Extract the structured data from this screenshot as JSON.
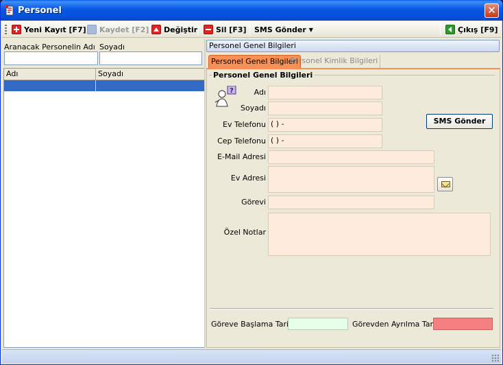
{
  "window": {
    "title": "Personel"
  },
  "toolbar": {
    "new_label": "Yeni Kayıt [F7]",
    "save_label": "Kaydet [F2]",
    "edit_label": "Değiştir",
    "delete_label": "Sil  [F3]",
    "sms_label": "SMS Gönder",
    "exit_label": "Çıkış [F9]"
  },
  "search": {
    "name_label": "Aranacak Personelin Adı",
    "surname_label": "Soyadı",
    "name_value": "",
    "surname_value": ""
  },
  "grid": {
    "columns": [
      "Adı",
      "Soyadı"
    ],
    "rows": [
      [
        "",
        ""
      ]
    ]
  },
  "details": {
    "panel_title": "Personel Genel Bilgileri",
    "tabs": [
      "Personel Genel Bilgileri",
      "Personel Kimlik Bilgileri"
    ],
    "group_title": "Personel Genel Bilgileri",
    "fields": {
      "ad": {
        "label": "Adı",
        "value": ""
      },
      "soyad": {
        "label": "Soyadı",
        "value": ""
      },
      "ev_tel": {
        "label": "Ev Telefonu",
        "value": "(   )   -"
      },
      "cep_tel": {
        "label": "Cep Telefonu",
        "value": "(   )   -"
      },
      "email": {
        "label": "E-Mail Adresi",
        "value": ""
      },
      "ev_adres": {
        "label": "Ev Adresi",
        "value": ""
      },
      "gorev": {
        "label": "Görevi",
        "value": ""
      },
      "notlar": {
        "label": "Özel Notlar",
        "value": ""
      }
    },
    "sms_button": "SMS Gönder",
    "start_date_label": "Göreve Başlama Tarihi",
    "end_date_label": "Görevden Ayrılma Tarihi",
    "start_date_value": "",
    "end_date_value": ""
  },
  "colors": {
    "title_bar": "#0a5fef",
    "active_tab": "#f59056",
    "field_bg": "#fdebdc",
    "selected_row": "#316ac5",
    "start_date_bg": "#e6ffe8",
    "end_date_bg": "#f48080"
  }
}
